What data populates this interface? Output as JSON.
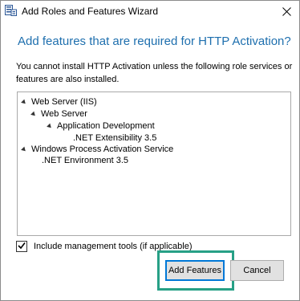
{
  "window": {
    "title": "Add Roles and Features Wizard",
    "close_symbol": "×"
  },
  "dialog": {
    "heading": "Add features that are required for HTTP Activation?",
    "message": "You cannot install HTTP Activation unless the following role services or features are also installed."
  },
  "tree": {
    "items": [
      {
        "label": "Web Server (IIS)",
        "expanded": true
      },
      {
        "label": "Web Server",
        "expanded": true
      },
      {
        "label": "Application Development",
        "expanded": true
      },
      {
        "label": ".NET Extensibility 3.5",
        "expanded": false
      },
      {
        "label": "Windows Process Activation Service",
        "expanded": true
      },
      {
        "label": ".NET Environment 3.5",
        "expanded": false
      }
    ]
  },
  "options": {
    "include_tools_label": "Include management tools (if applicable)",
    "include_tools_checked": true
  },
  "buttons": {
    "add_features": "Add Features",
    "cancel": "Cancel"
  },
  "colors": {
    "heading": "#1e6fae",
    "highlight": "#27a086",
    "primary_border": "#0078d7"
  },
  "icons": {
    "app": "server-manager-icon",
    "close": "close-icon",
    "expand": "expand-arrow-icon",
    "check": "checkmark-icon"
  }
}
